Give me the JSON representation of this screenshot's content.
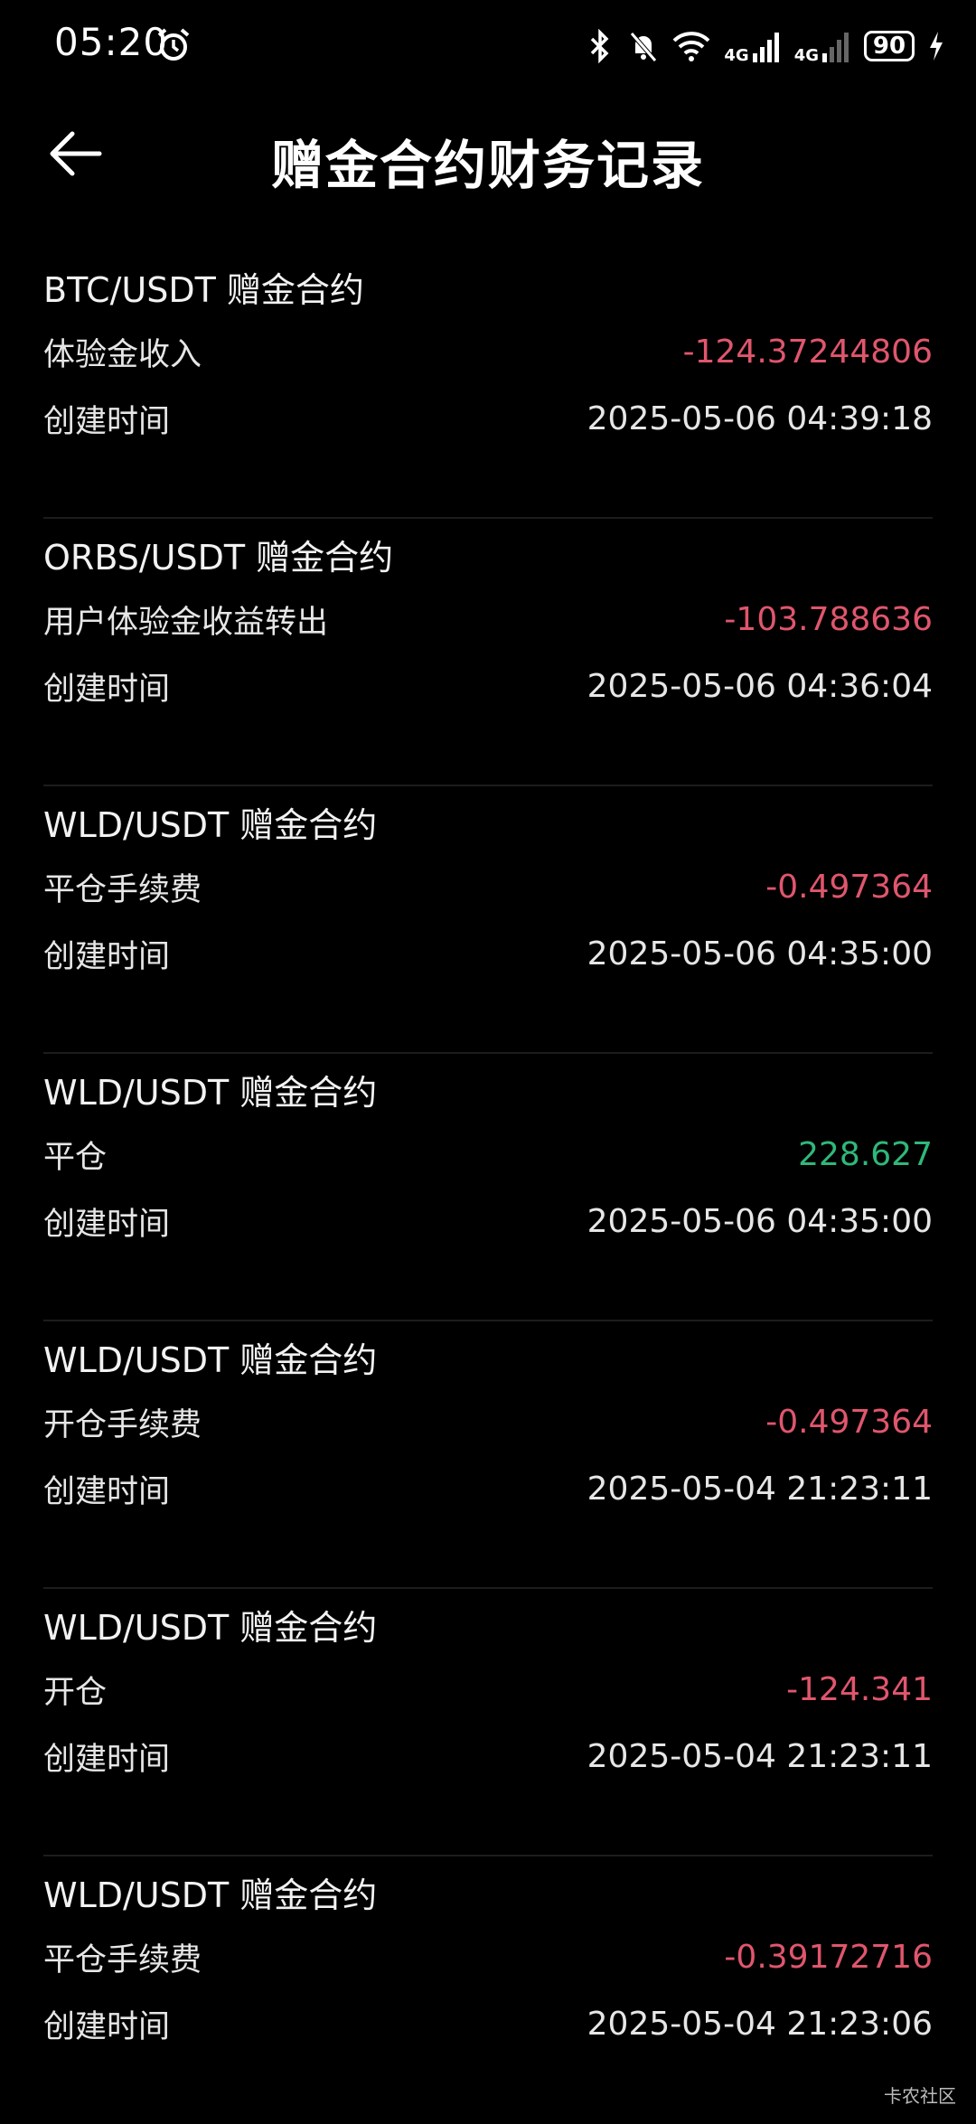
{
  "status_bar": {
    "time": "05:20",
    "battery": "90",
    "net1": "4G",
    "net2": "4G"
  },
  "header": {
    "title": "赠金合约财务记录"
  },
  "records": [
    {
      "title": "BTC/USDT 赠金合约",
      "type": "体验金收入",
      "amount": "-124.37244806",
      "amount_sign": "neg",
      "time_label": "创建时间",
      "time": "2025-05-06 04:39:18"
    },
    {
      "title": "ORBS/USDT 赠金合约",
      "type": "用户体验金收益转出",
      "amount": "-103.788636",
      "amount_sign": "neg",
      "time_label": "创建时间",
      "time": "2025-05-06 04:36:04"
    },
    {
      "title": "WLD/USDT 赠金合约",
      "type": "平仓手续费",
      "amount": "-0.497364",
      "amount_sign": "neg",
      "time_label": "创建时间",
      "time": "2025-05-06 04:35:00"
    },
    {
      "title": "WLD/USDT 赠金合约",
      "type": "平仓",
      "amount": "228.627",
      "amount_sign": "pos",
      "time_label": "创建时间",
      "time": "2025-05-06 04:35:00"
    },
    {
      "title": "WLD/USDT 赠金合约",
      "type": "开仓手续费",
      "amount": "-0.497364",
      "amount_sign": "neg",
      "time_label": "创建时间",
      "time": "2025-05-04 21:23:11"
    },
    {
      "title": "WLD/USDT 赠金合约",
      "type": "开仓",
      "amount": "-124.341",
      "amount_sign": "neg",
      "time_label": "创建时间",
      "time": "2025-05-04 21:23:11"
    },
    {
      "title": "WLD/USDT 赠金合约",
      "type": "平仓手续费",
      "amount": "-0.39172716",
      "amount_sign": "neg",
      "time_label": "创建时间",
      "time": "2025-05-04 21:23:06"
    }
  ],
  "watermark": "卡农社区",
  "colors": {
    "negative": "#e0566d",
    "positive": "#2fb87a",
    "background": "#000000"
  }
}
